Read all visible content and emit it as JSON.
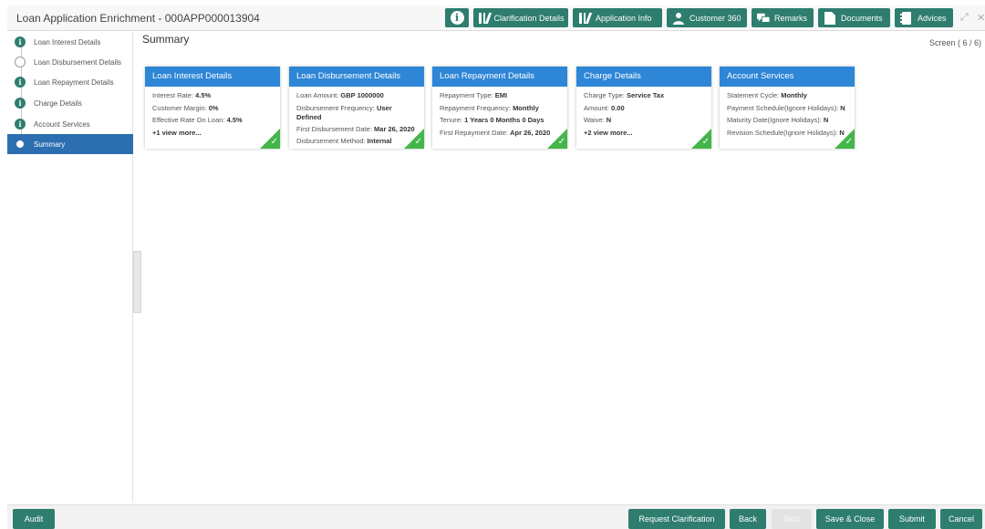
{
  "window": {
    "title": "Loan Application Enrichment - 000APP000013904",
    "controls": {
      "expand": "⤢",
      "close": "✕"
    }
  },
  "toolbar": {
    "info_label": "i",
    "clarification_label": "Clarification Details",
    "application_info_label": "Application Info",
    "customer360_label": "Customer 360",
    "remarks_label": "Remarks",
    "documents_label": "Documents",
    "advices_label": "Advices"
  },
  "sidebar": {
    "items": [
      {
        "label": "Loan Interest Details",
        "icon": "info-icon",
        "state": "done"
      },
      {
        "label": "Loan Disbursement Details",
        "icon": "",
        "state": "pending"
      },
      {
        "label": "Loan Repayment Details",
        "icon": "info-icon",
        "state": "done"
      },
      {
        "label": "Charge Details",
        "icon": "info-icon",
        "state": "done"
      },
      {
        "label": "Account Services",
        "icon": "info-icon",
        "state": "done"
      },
      {
        "label": "Summary",
        "icon": "",
        "state": "active"
      }
    ]
  },
  "main": {
    "title": "Summary",
    "screen_indicator": "Screen ( 6 / 6)"
  },
  "cards": [
    {
      "title": "Loan Interest Details",
      "rows": [
        {
          "label": "Interest Rate:",
          "value": "4.5%"
        },
        {
          "label": "Customer Margin:",
          "value": "0%"
        },
        {
          "label": "Effective Rate On Loan:",
          "value": "4.5%"
        }
      ],
      "more": "+1 view more..."
    },
    {
      "title": "Loan Disbursement Details",
      "rows": [
        {
          "label": "Loan Amount:",
          "value": "GBP 1000000"
        },
        {
          "label": "Disbursement Frequency:",
          "value": "User Defined"
        },
        {
          "label": "First Disbursement Date:",
          "value": "Mar 26, 2020"
        },
        {
          "label": "Disbursement Method:",
          "value": "Internal"
        }
      ]
    },
    {
      "title": "Loan Repayment Details",
      "rows": [
        {
          "label": "Repayment Type:",
          "value": "EMI"
        },
        {
          "label": "Repayment Frequency:",
          "value": "Monthly"
        },
        {
          "label": "Tenure:",
          "value": "1 Years 0 Months 0 Days"
        },
        {
          "label": "First Repayment Date:",
          "value": "Apr 26, 2020"
        }
      ]
    },
    {
      "title": "Charge Details",
      "rows": [
        {
          "label": "Charge Type:",
          "value": "Service Tax"
        },
        {
          "label": "Amount:",
          "value": "0.00"
        },
        {
          "label": "Waive:",
          "value": "N"
        }
      ],
      "more": "+2 view more..."
    },
    {
      "title": "Account Services",
      "rows": [
        {
          "label": "Statement Cycle:",
          "value": "Monthly"
        },
        {
          "label": "Payment Schedule(Ignore Holidays):",
          "value": "N"
        },
        {
          "label": "Maturity Date(Ignore Holidays):",
          "value": "N"
        },
        {
          "label": "Revision Schedule(Ignore Holidays):",
          "value": "N"
        }
      ]
    }
  ],
  "footer": {
    "audit": "Audit",
    "request_clarification": "Request Clarification",
    "back": "Back",
    "next": "Next",
    "save_close": "Save & Close",
    "submit": "Submit",
    "cancel": "Cancel"
  },
  "colors": {
    "toolbar_button": "#2e7d6e",
    "card_header": "#2d86d6",
    "active_nav": "#2c6fb0",
    "complete_corner": "#43b549"
  }
}
